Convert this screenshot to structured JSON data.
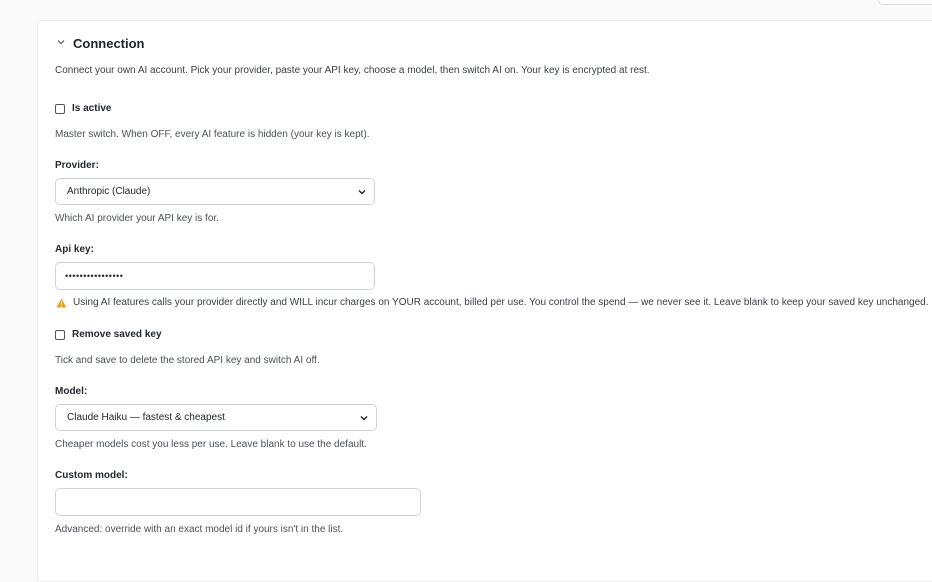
{
  "section": {
    "title": "Connection",
    "intro": "Connect your own AI account. Pick your provider, paste your API key, choose a model, then switch AI on. Your key is encrypted at rest."
  },
  "is_active": {
    "label": "Is active",
    "checked": false,
    "help": "Master switch. When OFF, every AI feature is hidden (your key is kept)."
  },
  "provider": {
    "label": "Provider:",
    "value": "Anthropic (Claude)",
    "help": "Which AI provider your API key is for."
  },
  "api_key": {
    "label": "Api key:",
    "value": "••••••••••••••••",
    "warning": "Using AI features calls your provider directly and WILL incur charges on YOUR account, billed per use. You control the spend — we never see it. Leave blank to keep your saved key unchanged."
  },
  "remove_key": {
    "label": "Remove saved key",
    "checked": false,
    "help": "Tick and save to delete the stored API key and switch AI off."
  },
  "model": {
    "label": "Model:",
    "value": "Claude Haiku — fastest & cheapest",
    "help": "Cheaper models cost you less per use. Leave blank to use the default."
  },
  "custom_model": {
    "label": "Custom model:",
    "value": "",
    "help": "Advanced: override with an exact model id if yours isn't in the list."
  },
  "colors": {
    "warning_icon": "#e8a317",
    "border": "#cfd4d9"
  }
}
